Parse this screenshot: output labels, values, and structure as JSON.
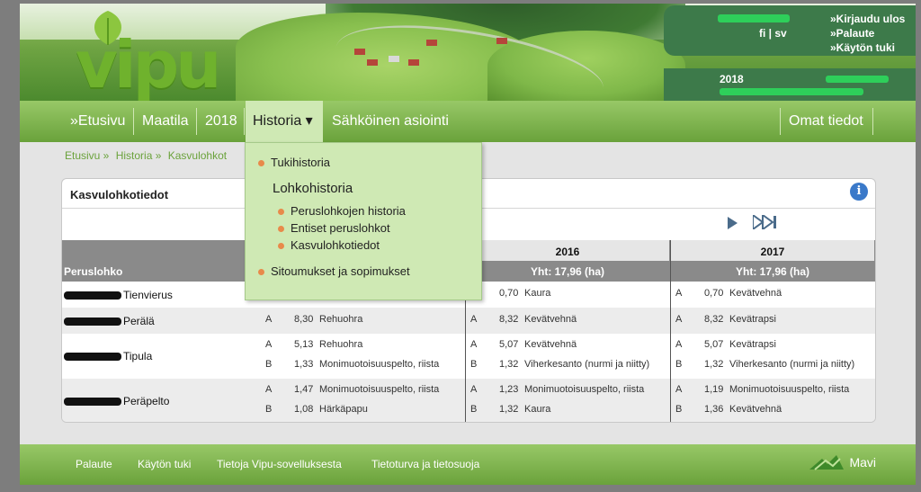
{
  "banner": {
    "logo_text": "vipu",
    "lang_switch": "fi | sv",
    "links": [
      "»Kirjaudu ulos",
      "»Palaute",
      "»Käytön tuki"
    ],
    "year": "2018"
  },
  "nav": {
    "items": [
      "»Etusivu",
      "Maatila",
      "2018",
      "Historia ▾",
      "Sähköinen asiointi"
    ],
    "right_item": "Omat tiedot"
  },
  "breadcrumb": [
    "Etusivu »",
    "Historia »",
    "Kasvulohkot"
  ],
  "panel": {
    "title": "Kasvulohkotiedot",
    "info_icon": "info-icon"
  },
  "dropdown": {
    "tukihistoria": "Tukihistoria",
    "lohkohistoria_heading": "Lohkohistoria",
    "lohko_items": [
      "Peruslohkojen historia",
      "Entiset peruslohkot",
      "Kasvulohkotiedot"
    ],
    "sitoumukset": "Sitoumukset ja sopimukset"
  },
  "table": {
    "col_peruslohko": "Peruslohko",
    "years": [
      "2016",
      "2017"
    ],
    "totals": [
      "Yht: 17,96 (ha)",
      "Yht: 17,96 (ha)"
    ],
    "rows": [
      {
        "name": "Tienvierus",
        "c2015": [],
        "c2016": [
          [
            "",
            "0,70",
            "Kaura"
          ]
        ],
        "c2017": [
          [
            "A",
            "0,70",
            "Kevätvehnä"
          ]
        ]
      },
      {
        "name": "Perälä",
        "c2015": [
          [
            "A",
            "8,30",
            "Rehuohra"
          ]
        ],
        "c2016": [
          [
            "A",
            "8,32",
            "Kevätvehnä"
          ]
        ],
        "c2017": [
          [
            "A",
            "8,32",
            "Kevätrapsi"
          ]
        ]
      },
      {
        "name": "Tipula",
        "c2015": [
          [
            "A",
            "5,13",
            "Rehuohra"
          ],
          [
            "B",
            "1,33",
            "Monimuotoisuuspelto, riista"
          ]
        ],
        "c2016": [
          [
            "A",
            "5,07",
            "Kevätvehnä"
          ],
          [
            "B",
            "1,32",
            "Viherkesanto (nurmi ja niitty)"
          ]
        ],
        "c2017": [
          [
            "A",
            "5,07",
            "Kevätrapsi"
          ],
          [
            "B",
            "1,32",
            "Viherkesanto (nurmi ja niitty)"
          ]
        ]
      },
      {
        "name": "Peräpelto",
        "c2015": [
          [
            "A",
            "1,47",
            "Monimuotoisuuspelto, riista"
          ],
          [
            "B",
            "1,08",
            "Härkäpapu"
          ]
        ],
        "c2016": [
          [
            "A",
            "1,23",
            "Monimuotoisuuspelto, riista"
          ],
          [
            "B",
            "1,32",
            "Kaura"
          ]
        ],
        "c2017": [
          [
            "A",
            "1,19",
            "Monimuotoisuuspelto, riista"
          ],
          [
            "B",
            "1,36",
            "Kevätvehnä"
          ]
        ]
      }
    ]
  },
  "footer": {
    "links": [
      "Palaute",
      "Käytön tuki",
      "Tietoja Vipu-sovelluksesta",
      "Tietoturva ja tietosuoja"
    ],
    "brand": "Mavi"
  },
  "colors": {
    "nav_green": "#6aa23b",
    "dropdown_bg": "#cfe9b4",
    "link_green": "#6aa23b",
    "header_gray": "#8a8a8a"
  }
}
